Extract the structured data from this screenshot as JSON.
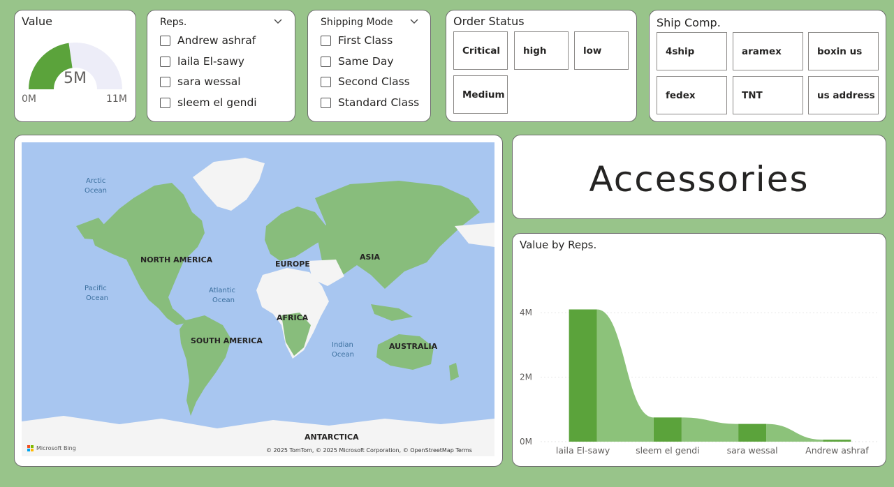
{
  "gauge": {
    "title": "Value",
    "value_label": "5M",
    "min_label": "0M",
    "max_label": "11M",
    "fill_fraction": 0.4545
  },
  "reps_slicer": {
    "title": "Reps.",
    "items": [
      "Andrew ashraf",
      "laila El-sawy",
      "sara wessal",
      "sleem el gendi"
    ]
  },
  "shipping_slicer": {
    "title": "Shipping Mode",
    "items": [
      "First Class",
      "Same Day",
      "Second Class",
      "Standard Class"
    ]
  },
  "order_status": {
    "title": "Order Status",
    "items": [
      "Critical",
      "high",
      "low",
      "Medium"
    ]
  },
  "ship_comp": {
    "title": "Ship Comp.",
    "items": [
      "4ship",
      "aramex",
      "boxin us",
      "fedex",
      "TNT",
      "us address"
    ]
  },
  "map": {
    "labels": {
      "north_america": "NORTH AMERICA",
      "south_america": "SOUTH AMERICA",
      "europe": "EUROPE",
      "asia": "ASIA",
      "africa": "AFRICA",
      "australia": "AUSTRALIA",
      "antarctica": "ANTARCTICA",
      "arctic_1": "Arctic",
      "arctic_2": "Ocean",
      "pacific_1": "Pacific",
      "pacific_2": "Ocean",
      "atlantic_1": "Atlantic",
      "atlantic_2": "Ocean",
      "indian_1": "Indian",
      "indian_2": "Ocean"
    },
    "attribution": "© 2025 TomTom, © 2025 Microsoft Corporation, © OpenStreetMap  Terms",
    "brand": "Microsoft Bing"
  },
  "category_card": {
    "text": "Accessories"
  },
  "chart_data": {
    "type": "bar",
    "title": "Value by Reps.",
    "categories": [
      "laila El-sawy",
      "sleem el gendi",
      "sara wessal",
      "Andrew ashraf"
    ],
    "values": [
      4.1,
      0.75,
      0.55,
      0.06
    ],
    "y_ticks": [
      "0M",
      "2M",
      "4M"
    ],
    "ylim": [
      0,
      4.5
    ],
    "xlabel": "",
    "ylabel": "",
    "colors": {
      "bar": "#5ba33b",
      "ribbon": "#8cc27a"
    }
  }
}
